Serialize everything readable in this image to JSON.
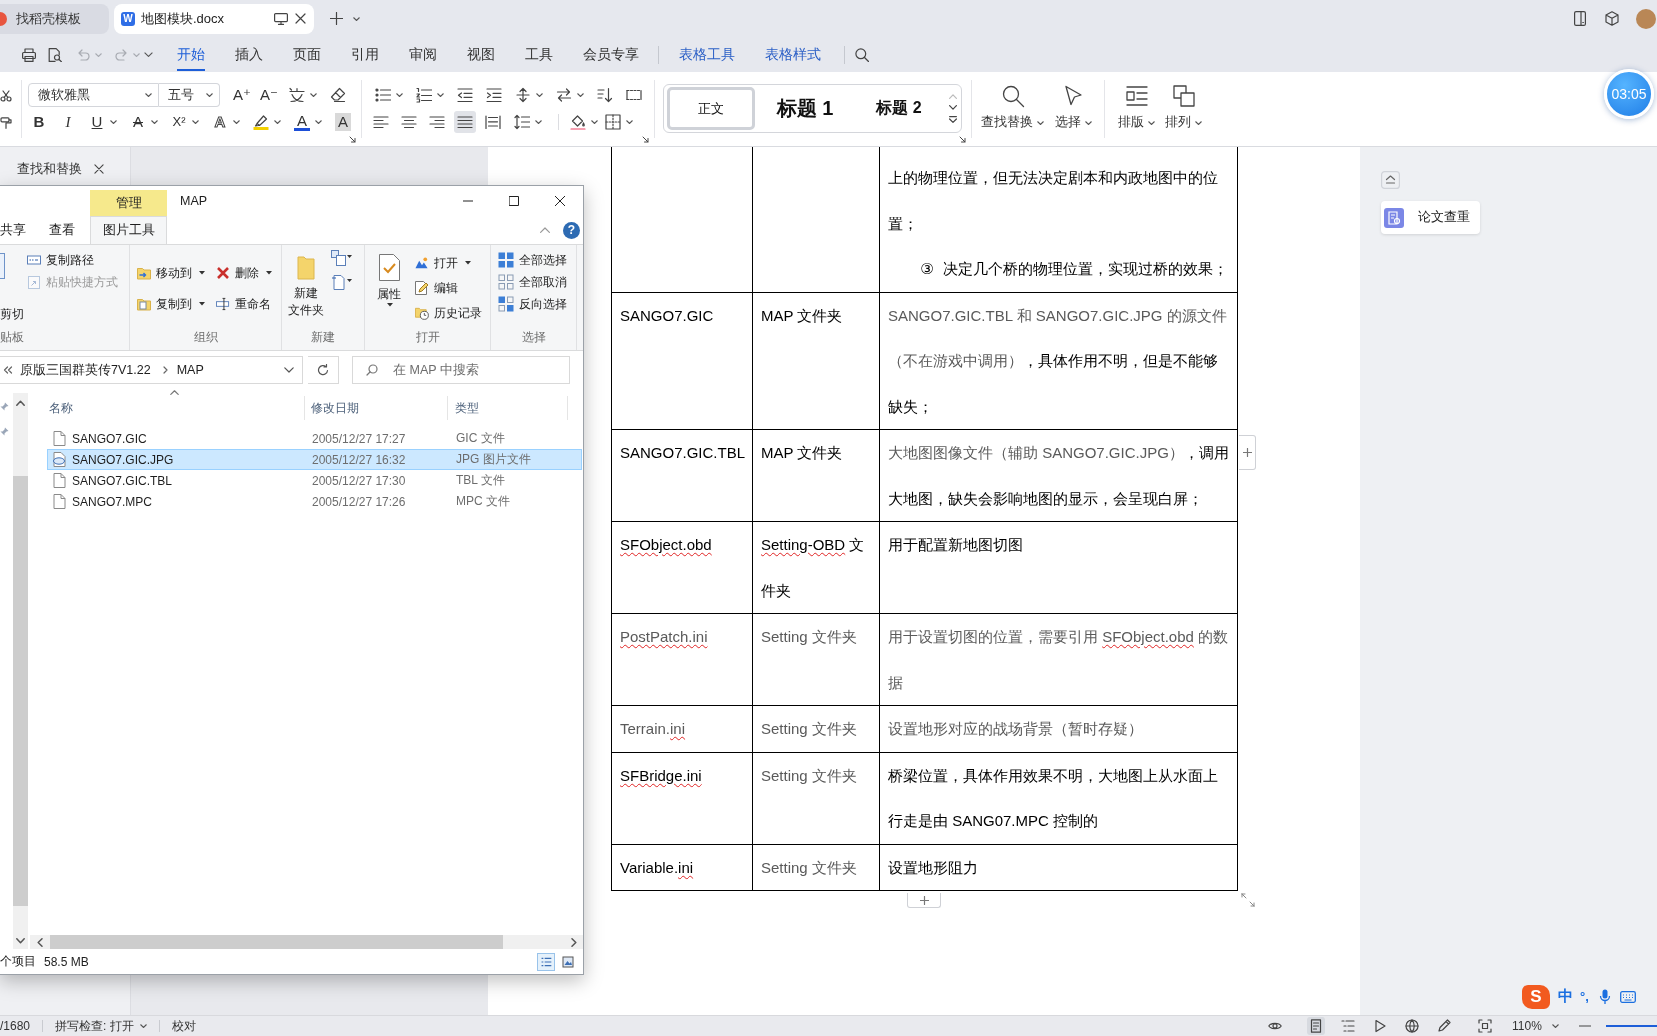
{
  "browser_tabs": [
    {
      "label": "找稻壳模板",
      "selected": false
    },
    {
      "label": "地图模块.docx",
      "badge": "W",
      "selected": true
    }
  ],
  "menu": [
    {
      "label": "开始",
      "kind": "main",
      "selected": true
    },
    {
      "label": "插入",
      "kind": "main",
      "selected": false
    },
    {
      "label": "页面",
      "kind": "main",
      "selected": false
    },
    {
      "label": "引用",
      "kind": "main",
      "selected": false
    },
    {
      "label": "审阅",
      "kind": "main",
      "selected": false
    },
    {
      "label": "视图",
      "kind": "main",
      "selected": false
    },
    {
      "label": "工具",
      "kind": "main",
      "selected": false
    },
    {
      "label": "会员专享",
      "kind": "main",
      "selected": false
    },
    {
      "label": "表格工具",
      "kind": "context",
      "selected": false
    },
    {
      "label": "表格样式",
      "kind": "context",
      "selected": false
    }
  ],
  "ribbon": {
    "font_name": "微软雅黑",
    "font_size": "五号",
    "glyphs": {
      "grow": "A⁺",
      "shrink": "A⁻",
      "bold": "B",
      "italic": "I",
      "underline": "U",
      "strike": "A",
      "superscript": "X²",
      "effect": "A",
      "font_color": "A",
      "shading": "A"
    },
    "alignment": [
      {
        "selected": false
      },
      {
        "selected": false
      },
      {
        "selected": false
      },
      {
        "selected": true
      },
      {
        "selected": false
      }
    ],
    "styles": [
      {
        "label": "正文",
        "kind": "body",
        "selected": true
      },
      {
        "label": "标题 1",
        "kind": "heading1",
        "selected": false
      },
      {
        "label": "标题 2",
        "kind": "heading2",
        "selected": false
      }
    ],
    "tools": [
      {
        "label": "查找替换"
      },
      {
        "label": "选择"
      },
      {
        "label": "排版"
      },
      {
        "label": "排列"
      }
    ]
  },
  "timer": "03:05",
  "left_pane": {
    "title": "查找和替换"
  },
  "explorer": {
    "context_tab": "管理",
    "title": "MAP",
    "tabs": [
      {
        "label": "共享",
        "selected": false
      },
      {
        "label": "查看",
        "selected": false
      },
      {
        "label": "图片工具",
        "selected": true
      }
    ],
    "help": "?",
    "groups": [
      {
        "label": "贴板",
        "items": [
          {
            "label": "剪切",
            "disabled": false
          },
          {
            "label": "复制路径",
            "disabled": false
          },
          {
            "label": "粘贴快捷方式",
            "disabled": true
          }
        ]
      },
      {
        "label": "组织",
        "items": [
          {
            "label": "移动到",
            "disabled": false
          },
          {
            "label": "删除",
            "disabled": false
          },
          {
            "label": "复制到",
            "disabled": false
          },
          {
            "label": "重命名",
            "disabled": false
          }
        ]
      },
      {
        "label": "新建",
        "items": [
          {
            "lines": [
              "新建",
              "文件夹"
            ],
            "disabled": false
          }
        ]
      },
      {
        "label": "打开",
        "items": [
          {
            "label": "属性",
            "disabled": false
          },
          {
            "label": "打开",
            "disabled": false
          },
          {
            "label": "编辑",
            "disabled": false
          },
          {
            "label": "历史记录",
            "disabled": false
          }
        ]
      },
      {
        "label": "选择",
        "items": [
          {
            "label": "全部选择",
            "disabled": false
          },
          {
            "label": "全部取消",
            "disabled": false
          },
          {
            "label": "反向选择",
            "disabled": false
          }
        ]
      }
    ],
    "path": [
      "原版三国群英传7V1.22",
      "MAP"
    ],
    "search_placeholder": "在 MAP 中搜索",
    "columns": [
      "名称",
      "修改日期",
      "类型"
    ],
    "files": [
      {
        "name": "SANGO7.GIC",
        "date": "2005/12/27 17:27",
        "type": "GIC 文件",
        "kind": "file",
        "selected": false
      },
      {
        "name": "SANGO7.GIC.JPG",
        "date": "2005/12/27 16:32",
        "type": "JPG 图片文件",
        "kind": "image",
        "selected": true
      },
      {
        "name": "SANGO7.GIC.TBL",
        "date": "2005/12/27 17:30",
        "type": "TBL 文件",
        "kind": "file",
        "selected": false
      },
      {
        "name": "SANGO7.MPC",
        "date": "2005/12/27 17:26",
        "type": "MPC 文件",
        "kind": "file",
        "selected": false
      }
    ],
    "status": {
      "count": "个项目",
      "size": "58.5 MB"
    },
    "views": [
      {
        "selected": true
      },
      {
        "selected": false
      }
    ]
  },
  "table": {
    "rows": [
      {
        "column_3": [
          {
            "kind": "text",
            "runs": [
              {
                "text": "上的物理位置，但无法决定剧本和内政地图中的位置；",
                "muted": false,
                "flagged": false
              }
            ]
          },
          {
            "kind": "numbered",
            "marker": "③",
            "runs": [
              {
                "text": "决定几个桥的物理位置，实现过桥的效果；",
                "muted": false,
                "flagged": false
              }
            ]
          }
        ]
      },
      {
        "column_1": [
          {
            "text": "SANGO7.GIC",
            "muted": false,
            "flagged": false
          }
        ],
        "column_2": [
          {
            "text": "MAP 文件夹",
            "muted": false,
            "flagged": false
          }
        ],
        "column_3": [
          {
            "kind": "text",
            "runs": [
              {
                "text": "SANGO7.GIC.TBL 和 SANGO7.GIC.JPG 的源文件（不在游戏中调用）",
                "muted": true,
                "flagged": false
              },
              {
                "text": "，具体作用不明，但是不能够缺失；",
                "muted": false,
                "flagged": false
              }
            ]
          }
        ]
      },
      {
        "column_1": [
          {
            "text": "SANGO7.GIC.TBL",
            "muted": false,
            "flagged": false
          }
        ],
        "column_2": [
          {
            "text": "MAP 文件夹",
            "muted": false,
            "flagged": false
          }
        ],
        "column_3": [
          {
            "kind": "text",
            "runs": [
              {
                "text": "大地图图像文件（辅助 SANGO7.GIC.JPG）",
                "muted": true,
                "flagged": false
              },
              {
                "text": "，调用大地图，缺失会影响地图的显示，会呈现白屏；",
                "muted": false,
                "flagged": false
              }
            ]
          }
        ]
      },
      {
        "column_1": [
          {
            "text": "SFObject.obd",
            "muted": false,
            "flagged": true
          }
        ],
        "column_2": [
          {
            "text": "Setting-OBD",
            "muted": false,
            "flagged": true
          },
          {
            "text": " 文件夹",
            "muted": false,
            "flagged": false
          }
        ],
        "column_3": [
          {
            "kind": "text",
            "runs": [
              {
                "text": "用于配置新地图切图",
                "muted": false,
                "flagged": false
              }
            ]
          }
        ]
      },
      {
        "column_1": [
          {
            "text": "PostPatch.ini",
            "muted": true,
            "flagged": true
          }
        ],
        "column_2": [
          {
            "text": "Setting 文件夹",
            "muted": true,
            "flagged": false
          }
        ],
        "column_3": [
          {
            "kind": "text",
            "runs": [
              {
                "text": "用于设置切图的位置，需要引用 ",
                "muted": true,
                "flagged": false
              },
              {
                "text": "SFObject.obd",
                "muted": true,
                "flagged": true
              },
              {
                "text": " 的数据",
                "muted": true,
                "flagged": false
              }
            ]
          }
        ]
      },
      {
        "column_1": [
          {
            "text": "Terrain.",
            "muted": true,
            "flagged": false
          },
          {
            "text": "ini",
            "muted": true,
            "flagged": true
          }
        ],
        "column_2": [
          {
            "text": "Setting 文件夹",
            "muted": true,
            "flagged": false
          }
        ],
        "column_3": [
          {
            "kind": "text",
            "runs": [
              {
                "text": "设置地形对应的战场背景（暂时存疑）",
                "muted": true,
                "flagged": false
              }
            ]
          }
        ]
      },
      {
        "column_1": [
          {
            "text": "SFBridge.ini",
            "muted": false,
            "flagged": true
          }
        ],
        "column_2": [
          {
            "text": "Setting 文件夹",
            "muted": true,
            "flagged": false
          }
        ],
        "column_3": [
          {
            "kind": "text",
            "runs": [
              {
                "text": "桥梁位置，具体作用效果不明，大地图上从水面上行走是由 SANG07.MPC 控制的",
                "muted": false,
                "flagged": false
              }
            ]
          }
        ]
      },
      {
        "column_1": [
          {
            "text": "Variable.",
            "muted": false,
            "flagged": false
          },
          {
            "text": "ini",
            "muted": false,
            "flagged": true
          }
        ],
        "column_2": [
          {
            "text": "Setting 文件夹",
            "muted": true,
            "flagged": false
          }
        ],
        "column_3": [
          {
            "kind": "text",
            "runs": [
              {
                "text": "设置地形阻力",
                "muted": false,
                "flagged": false
              }
            ]
          }
        ]
      }
    ]
  },
  "side_panel": {
    "button": "论文查重"
  },
  "ime": {
    "logo": "S",
    "mode": "中",
    "punctuation": "°,"
  },
  "status_bar": {
    "page": "/1680",
    "spellcheck": "拼写检查: 打开",
    "proofread": "校对",
    "views": [
      {
        "selected": true
      },
      {
        "selected": false
      },
      {
        "selected": false
      },
      {
        "selected": false
      }
    ],
    "zoom": "110%",
    "zoom_slider": {
      "level": 1
    }
  }
}
